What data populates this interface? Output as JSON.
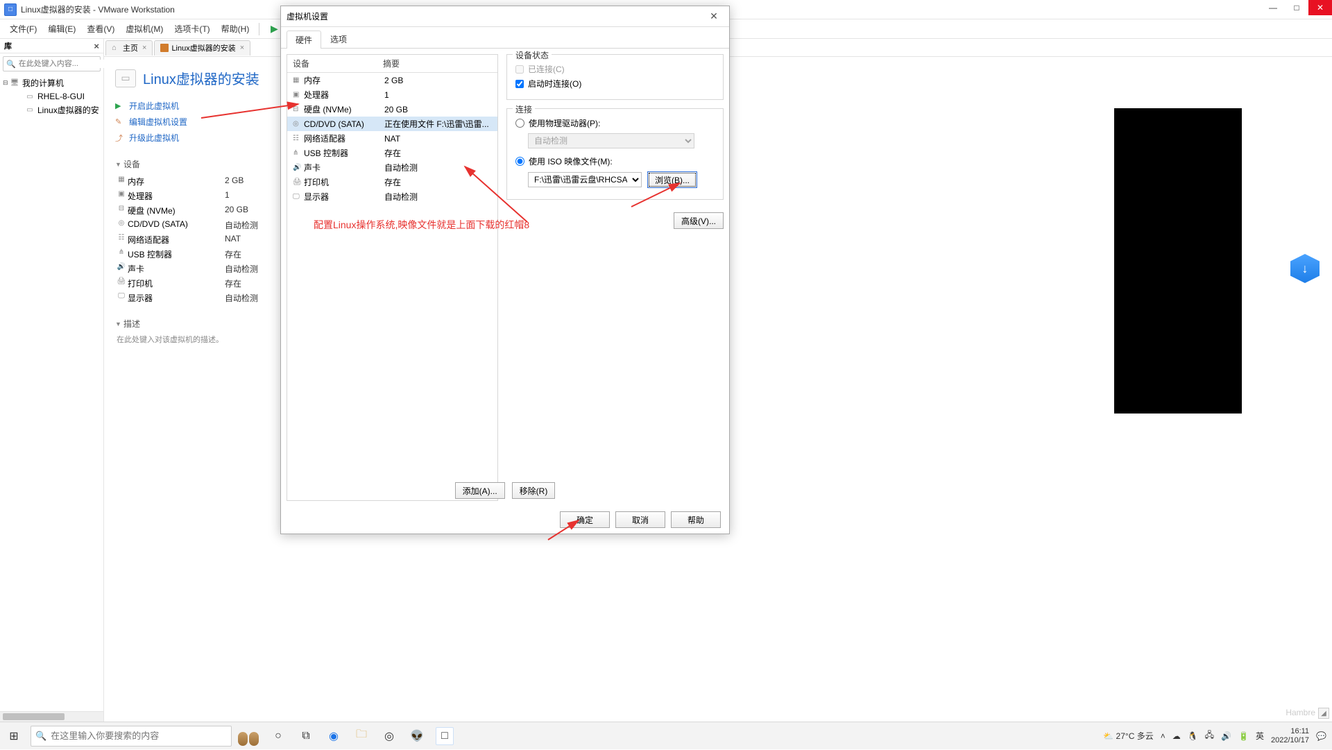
{
  "titlebar": {
    "title": "Linux虚拟器的安装 - VMware Workstation"
  },
  "menubar": {
    "items": [
      "文件(F)",
      "编辑(E)",
      "查看(V)",
      "虚拟机(M)",
      "选项卡(T)",
      "帮助(H)"
    ]
  },
  "library": {
    "header": "库",
    "search_placeholder": "在此处键入内容...",
    "root": "我的计算机",
    "children": [
      "RHEL-8-GUI",
      "Linux虚拟器的安"
    ]
  },
  "tabs": {
    "home": "主页",
    "vm": "Linux虚拟器的安装"
  },
  "vm": {
    "title": "Linux虚拟器的安装",
    "actions": {
      "power_on": "开启此虚拟机",
      "edit": "编辑虚拟机设置",
      "upgrade": "升级此虚拟机"
    },
    "devices_header": "设备",
    "devices": [
      {
        "name": "内存",
        "value": "2 GB"
      },
      {
        "name": "处理器",
        "value": "1"
      },
      {
        "name": "硬盘 (NVMe)",
        "value": "20 GB"
      },
      {
        "name": "CD/DVD (SATA)",
        "value": "自动检测"
      },
      {
        "name": "网络适配器",
        "value": "NAT"
      },
      {
        "name": "USB 控制器",
        "value": "存在"
      },
      {
        "name": "声卡",
        "value": "自动检测"
      },
      {
        "name": "打印机",
        "value": "存在"
      },
      {
        "name": "显示器",
        "value": "自动检测"
      }
    ],
    "desc_header": "描述",
    "desc_placeholder": "在此处键入对该虚拟机的描述。"
  },
  "dialog": {
    "title": "虚拟机设置",
    "tab_hw": "硬件",
    "tab_opt": "选项",
    "col_device": "设备",
    "col_summary": "摘要",
    "rows": [
      {
        "name": "内存",
        "summary": "2 GB"
      },
      {
        "name": "处理器",
        "summary": "1"
      },
      {
        "name": "硬盘 (NVMe)",
        "summary": "20 GB"
      },
      {
        "name": "CD/DVD (SATA)",
        "summary": "正在使用文件 F:\\迅雷\\迅雷..."
      },
      {
        "name": "网络适配器",
        "summary": "NAT"
      },
      {
        "name": "USB 控制器",
        "summary": "存在"
      },
      {
        "name": "声卡",
        "summary": "自动检测"
      },
      {
        "name": "打印机",
        "summary": "存在"
      },
      {
        "name": "显示器",
        "summary": "自动检测"
      }
    ],
    "status_header": "设备状态",
    "connected": "已连接(C)",
    "connect_on": "启动时连接(O)",
    "connection_header": "连接",
    "use_physical": "使用物理驱动器(P):",
    "auto_detect": "自动检测",
    "use_iso": "使用 ISO 映像文件(M):",
    "iso_path": "F:\\迅雷\\迅雷云盘\\RHCSA需要...",
    "browse": "浏览(B)...",
    "advanced": "高级(V)...",
    "add": "添加(A)...",
    "remove": "移除(R)",
    "ok": "确定",
    "cancel": "取消",
    "help": "帮助"
  },
  "annotation": "配置Linux操作系统,映像文件就是上面下载的红帽8",
  "taskbar": {
    "search_placeholder": "在这里输入你要搜索的内容",
    "weather": "27°C 多云",
    "ime": "英",
    "time": "16:11",
    "date": "2022/10/17"
  },
  "watermark": "Hambre"
}
